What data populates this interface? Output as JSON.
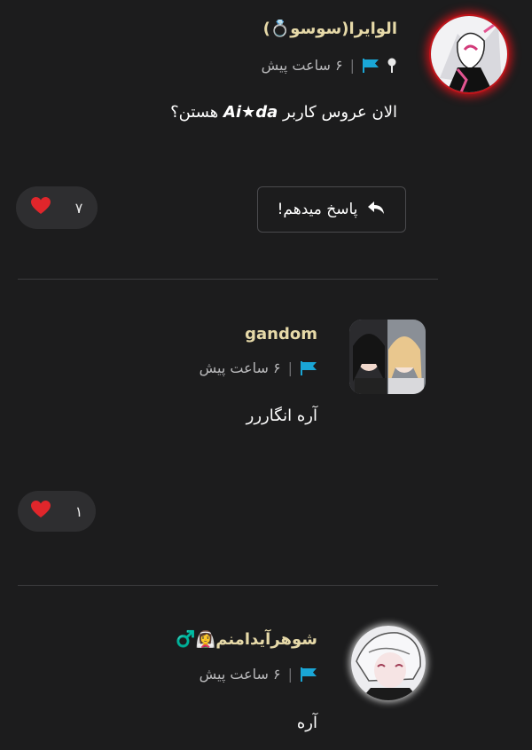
{
  "comments": [
    {
      "author": "الوایرا(سوسو💍)",
      "time": "۶ ساعت پیش",
      "text_prefix": "الان عروس کاربر ",
      "text_bold": "Ai★da",
      "text_suffix": " هستن؟",
      "reply_label": "پاسخ میدهم!",
      "likes": "۷",
      "has_pin": true
    },
    {
      "author": "gandom",
      "time": "۶ ساعت پیش",
      "text": "آره انگاررر",
      "likes": "۱"
    },
    {
      "author": "شوهرآیدامنم👰‍♀️♂️",
      "time": "۶ ساعت پیش",
      "text": "آره"
    }
  ],
  "colors": {
    "background": "#1c1c1d",
    "flag": "#1aa6d6",
    "heart": "#e0262b",
    "author_accent": "#e6d9a8"
  },
  "icons": [
    "location-pin-icon",
    "flag-icon",
    "reply-arrow-icon",
    "heart-icon"
  ]
}
